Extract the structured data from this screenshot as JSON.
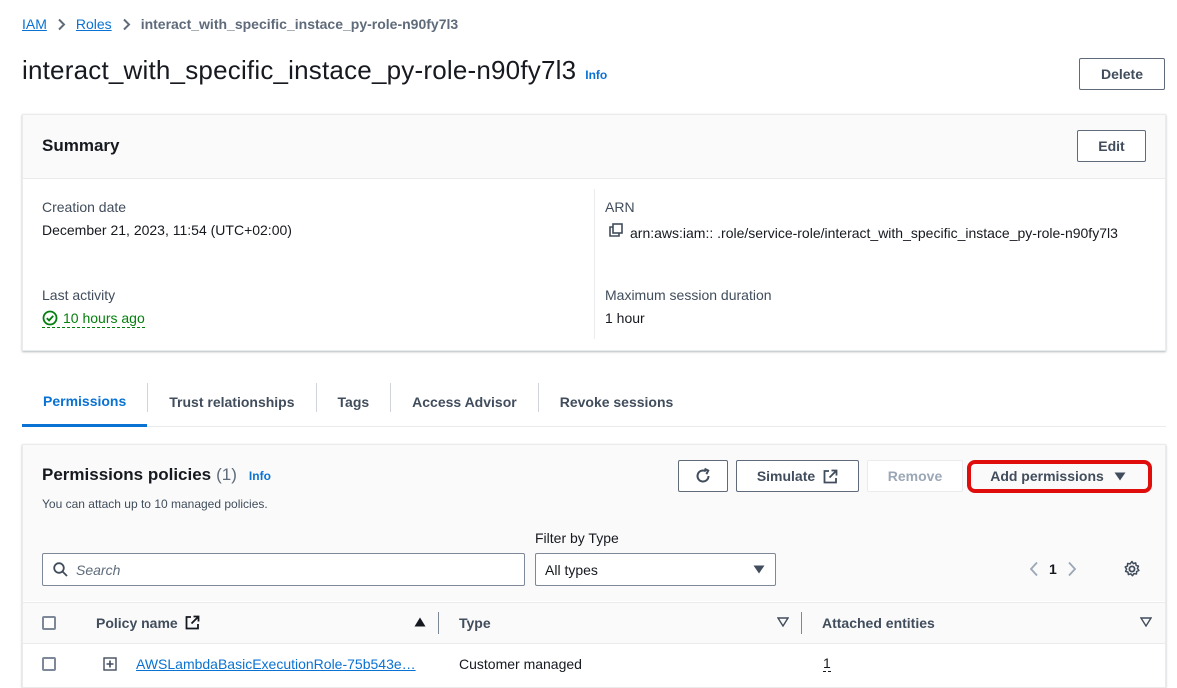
{
  "breadcrumb": {
    "items": [
      "IAM",
      "Roles"
    ],
    "current": "interact_with_specific_instace_py-role-n90fy7l3"
  },
  "header": {
    "title": "interact_with_specific_instace_py-role-n90fy7l3",
    "info": "Info",
    "delete_label": "Delete"
  },
  "summary": {
    "title": "Summary",
    "edit_label": "Edit",
    "creation_date_label": "Creation date",
    "creation_date": "December 21, 2023, 11:54 (UTC+02:00)",
    "last_activity_label": "Last activity",
    "last_activity": "10 hours ago",
    "arn_label": "ARN",
    "arn_value": "arn:aws:iam::                         .role/service-role/interact_with_specific_instace_py-role-n90fy7l3",
    "max_session_label": "Maximum session duration",
    "max_session": "1 hour"
  },
  "tabs": [
    {
      "label": "Permissions",
      "active": true
    },
    {
      "label": "Trust relationships",
      "active": false
    },
    {
      "label": "Tags",
      "active": false
    },
    {
      "label": "Access Advisor",
      "active": false
    },
    {
      "label": "Revoke sessions",
      "active": false
    }
  ],
  "permissions": {
    "title": "Permissions policies",
    "count": "(1)",
    "info": "Info",
    "description": "You can attach up to 10 managed policies.",
    "simulate_label": "Simulate",
    "remove_label": "Remove",
    "add_label": "Add permissions",
    "filter_label": "Filter by Type",
    "search_placeholder": "Search",
    "filter_value": "All types",
    "page": "1",
    "columns": [
      "Policy name",
      "Type",
      "Attached entities"
    ],
    "rows": [
      {
        "name": "AWSLambdaBasicExecutionRole-75b543e…",
        "type": "Customer managed",
        "entities": "1"
      }
    ]
  },
  "colors": {
    "link": "#0972d3",
    "success": "#037f0c",
    "highlight": "#e00d0d",
    "text": "#16191f"
  }
}
